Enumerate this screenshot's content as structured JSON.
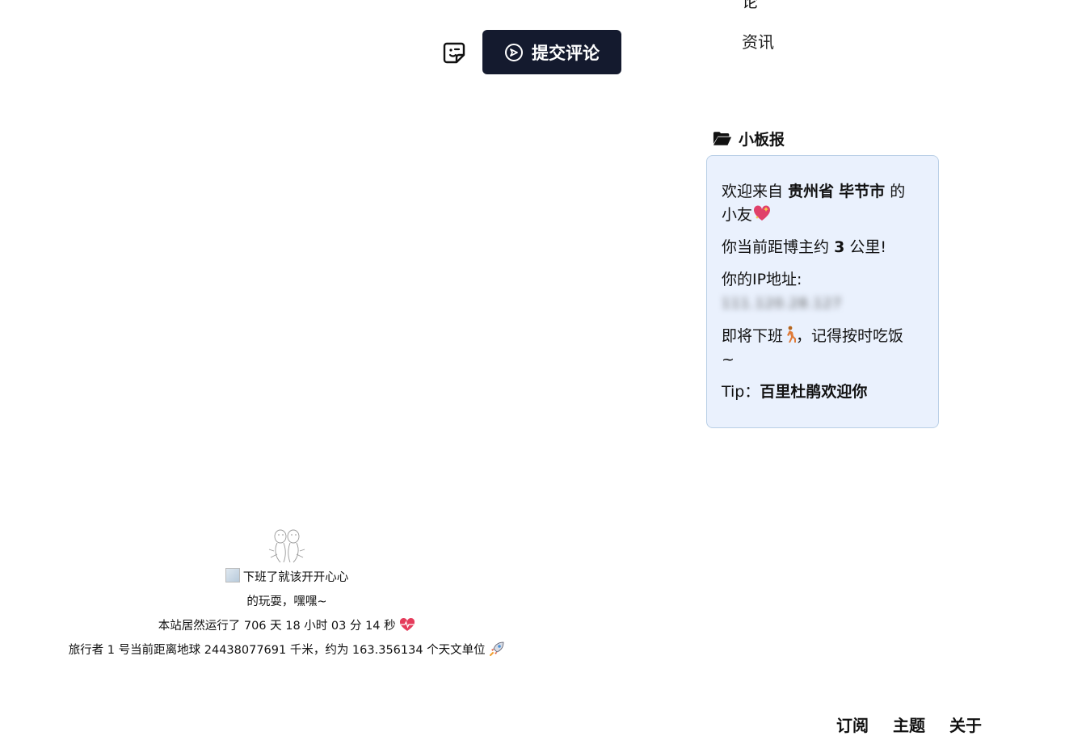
{
  "nav": {
    "cut_item": "论",
    "news_item": "资讯"
  },
  "comment": {
    "submit_label": "提交评论"
  },
  "board": {
    "title": "小板报",
    "welcome_prefix": "欢迎来自",
    "province": "贵州省",
    "city": "毕节市",
    "welcome_suffix_1": "的",
    "welcome_suffix_2": "小友",
    "distance_prefix": "你当前距博主约",
    "distance_value": "3",
    "distance_suffix": "公里!",
    "ip_label": "你的IP地址:",
    "ip_value": "111.120.28.127",
    "offwork_text_1": "即将下班",
    "offwork_text_2": "，记得按时吃饭",
    "offwork_tilde": "~",
    "tip_label": "Tip：",
    "tip_value": "百里杜鹃欢迎你"
  },
  "footer": {
    "image_alt_1": "下班了就该开开心心",
    "image_alt_2": "的玩耍，嘿嘿~",
    "runtime": "本站居然运行了 706 天 18 小时 03 分 14 秒",
    "voyager": "旅行者 1 号当前距离地球 24438077691 千米，约为 163.356134 个天文单位"
  },
  "bottom_nav": [
    "订阅",
    "主题",
    "关于"
  ],
  "colors": {
    "submit_bg": "#141a2e",
    "board_bg": "#eaf1fd",
    "board_border": "#b9cfe6"
  }
}
